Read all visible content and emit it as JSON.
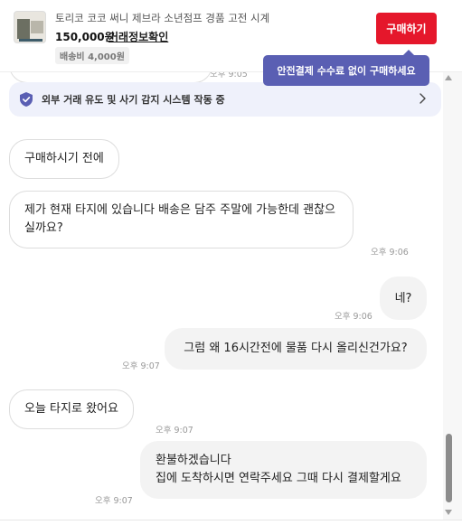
{
  "product": {
    "title": "토리코 코코 써니 제브라 소년점프 경품 고전 시계",
    "price": "150,000원",
    "info_link": "거래정보확인",
    "shipping": "배송비 4,000원",
    "buy_label": "구매하기"
  },
  "tooltip": {
    "text": "안전결제 수수료 없이 구매하세요"
  },
  "banner": {
    "text": "외부 거래 유도 및 사기 감지 시스템 작동 중"
  },
  "partial_time": "오후 9:05",
  "messages": [
    {
      "side": "them",
      "text": "구매하시기 전에",
      "time": ""
    },
    {
      "side": "them",
      "text": "제가 현재 타지에 있습니다 배송은 담주 주말에 가능한데 괜찮으실까요?",
      "time": "오후 9:06"
    },
    {
      "side": "mine",
      "text": "네?",
      "time": "오후 9:06"
    },
    {
      "side": "mine",
      "text": "그럼 왜 16시간전에 물품 다시 올리신건가요?",
      "time": "오후 9:07"
    },
    {
      "side": "them",
      "text": "오늘 타지로 왔어요",
      "time": "오후 9:07"
    },
    {
      "side": "mine",
      "text_lines": [
        "환불하겠습니다",
        "집에 도착하시면 연락주세요 그때 다시 결제할게요"
      ],
      "time": "오후 9:07"
    }
  ],
  "colors": {
    "buy": "#e5172b",
    "tooltip": "#5a5fb3",
    "banner_bg": "#eff1fb",
    "shield": "#5a5fb3"
  }
}
